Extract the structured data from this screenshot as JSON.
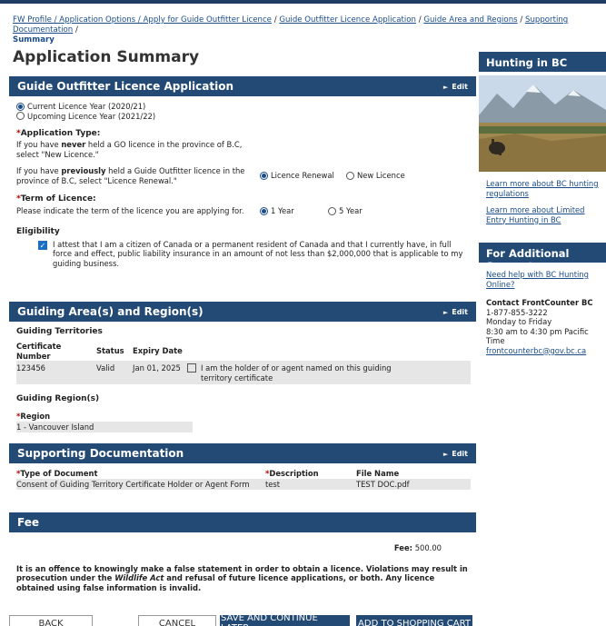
{
  "breadcrumb": {
    "items": [
      "FW Profile / Application Options / Apply for Guide Outfitter Licence",
      "Guide Outfitter Licence Application",
      "Guide Area and Regions",
      "Supporting Documentation"
    ],
    "current": "Summary"
  },
  "page_title": "Application Summary",
  "sections": {
    "licence": {
      "title": "Guide Outfitter Licence Application",
      "edit": "Edit",
      "year_options": [
        "Current Licence Year (2020/21)",
        "Upcoming Licence Year (2021/22)"
      ],
      "app_type_label": "Application Type:",
      "app_type_new_help_pre": "If you have ",
      "app_type_new_help_bold": "never",
      "app_type_new_help_post": " held a GO licence in the province of B.C, select \"New Licence.\"",
      "app_type_renew_help_pre": "If you have ",
      "app_type_renew_help_bold": "previously",
      "app_type_renew_help_post": " held a Guide Outfitter licence in the province of B.C, select \"Licence Renewal.\"",
      "app_type_options": [
        "Licence Renewal",
        "New Licence"
      ],
      "term_label": "Term of Licence:",
      "term_help": "Please indicate the term of the licence you are applying for.",
      "term_options": [
        "1 Year",
        "5 Year"
      ],
      "eligibility_label": "Eligibility",
      "eligibility_text": "I attest that I am a citizen of Canada or a permanent resident of Canada and that I currently have, in full force and effect, public liability insurance in an amount of not less than $2,000,000 that is applicable to my guiding business."
    },
    "guiding": {
      "title": "Guiding Area(s) and Region(s)",
      "edit": "Edit",
      "territories_label": "Guiding Territories",
      "columns": [
        "Certificate Number",
        "Status",
        "Expiry Date"
      ],
      "row": {
        "certificate": "123456",
        "status": "Valid",
        "expiry": "Jan 01, 2025",
        "holder": "I am the holder of or agent named on this guiding territory certificate"
      },
      "regions_label": "Guiding Region(s)",
      "region_label": "Region",
      "region_value": "1 - Vancouver Island"
    },
    "docs": {
      "title": "Supporting Documentation",
      "edit": "Edit",
      "columns": [
        "Type of Document",
        "Description",
        "File Name"
      ],
      "row": {
        "type": "Consent of Guiding Territory Certificate Holder or Agent Form",
        "description": "test",
        "file": "TEST DOC.pdf"
      }
    },
    "fee": {
      "title": "Fee",
      "label": "Fee:",
      "value": "500.00",
      "warning_pre": "It is an offence to knowingly make a false statement in order to obtain a licence. Violations may result in prosecution under the ",
      "warning_act": "Wildlife Act",
      "warning_post": " and refusal of future licence applications, or both. Any licence obtained using false information is invalid."
    }
  },
  "sidebar": {
    "hunting_title": "Hunting in BC",
    "links": [
      "Learn more about BC hunting regulations",
      "Learn more about Limited Entry Hunting in BC"
    ],
    "support_title": "For Additional Support",
    "support_link": "Need help with BC Hunting Online?",
    "contact_title": "Contact FrontCounter BC",
    "contact_lines": [
      "1-877-855-3222",
      "Monday to Friday",
      "8:30 am to 4:30 pm Pacific Time"
    ],
    "email": "frontcounterbc@gov.bc.ca"
  },
  "buttons": {
    "back": "BACK",
    "cancel": "CANCEL",
    "save": "SAVE AND CONTINUE LATER",
    "cart": "ADD TO SHOPPING CART"
  },
  "colors": {
    "header": "#234a74",
    "link": "#1a4c8c",
    "field_bg": "#e6e6e6"
  }
}
